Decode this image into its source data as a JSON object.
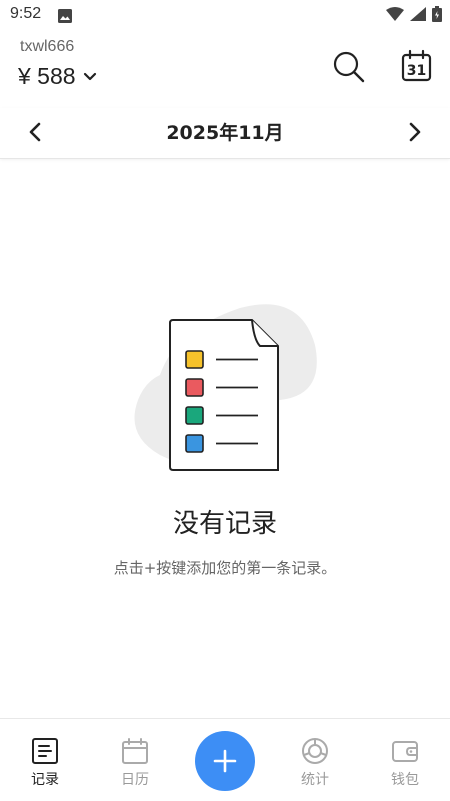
{
  "status_bar": {
    "time": "9:52",
    "icons": [
      "image-icon",
      "wifi-icon",
      "signal-icon",
      "battery-icon"
    ]
  },
  "header": {
    "account_name": "txwl666",
    "balance": "¥ 588",
    "actions": [
      "search-icon",
      "calendar-icon"
    ],
    "calendar_day": "31"
  },
  "month_nav": {
    "title": "2025年11月"
  },
  "empty_state": {
    "title": "没有记录",
    "hint": "点击+按键添加您的第一条记录。"
  },
  "bottom_nav": {
    "items": [
      {
        "label": "记录",
        "icon": "record-list-icon",
        "active": true
      },
      {
        "label": "日历",
        "icon": "calendar-icon",
        "active": false
      },
      {
        "label": "",
        "icon": "plus-icon",
        "active": false
      },
      {
        "label": "统计",
        "icon": "stats-icon",
        "active": false
      },
      {
        "label": "钱包",
        "icon": "wallet-icon",
        "active": false
      }
    ]
  },
  "colors": {
    "accent": "#3d8ef5",
    "active_text": "#222222",
    "inactive_text": "#9a9a9a",
    "illustration_yellow": "#f6c22b",
    "illustration_red": "#ea5a5f",
    "illustration_green": "#1aa77c",
    "illustration_blue": "#3a95e0"
  }
}
